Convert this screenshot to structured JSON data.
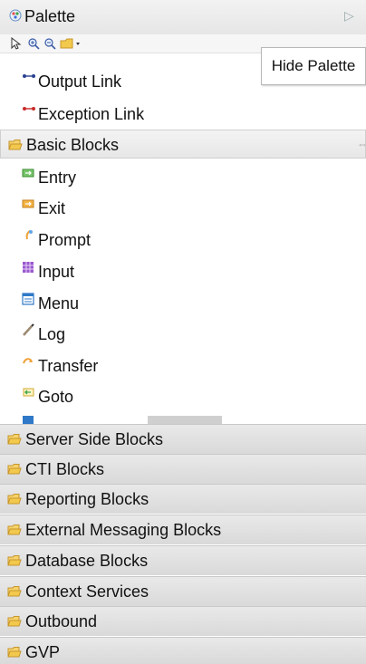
{
  "header": {
    "title": "Palette",
    "hide_arrow": "▷"
  },
  "toolbar": {
    "icons": [
      "select-icon",
      "zoom-in-icon",
      "zoom-out-icon",
      "folder-menu-icon"
    ]
  },
  "tooltip": "Hide Palette",
  "links": [
    {
      "label": "Output Link",
      "icon": "output-link-icon"
    },
    {
      "label": "Exception Link",
      "icon": "exception-link-icon"
    }
  ],
  "basic_blocks": {
    "title": "Basic Blocks",
    "items": [
      {
        "label": "Entry"
      },
      {
        "label": "Exit"
      },
      {
        "label": "Prompt"
      },
      {
        "label": "Input"
      },
      {
        "label": "Menu"
      },
      {
        "label": "Log"
      },
      {
        "label": "Transfer"
      },
      {
        "label": "Goto"
      }
    ]
  },
  "drawers": [
    "Server Side Blocks",
    "CTI Blocks",
    "Reporting Blocks",
    "External Messaging Blocks",
    "Database Blocks",
    "Context Services",
    "Outbound",
    "GVP"
  ]
}
